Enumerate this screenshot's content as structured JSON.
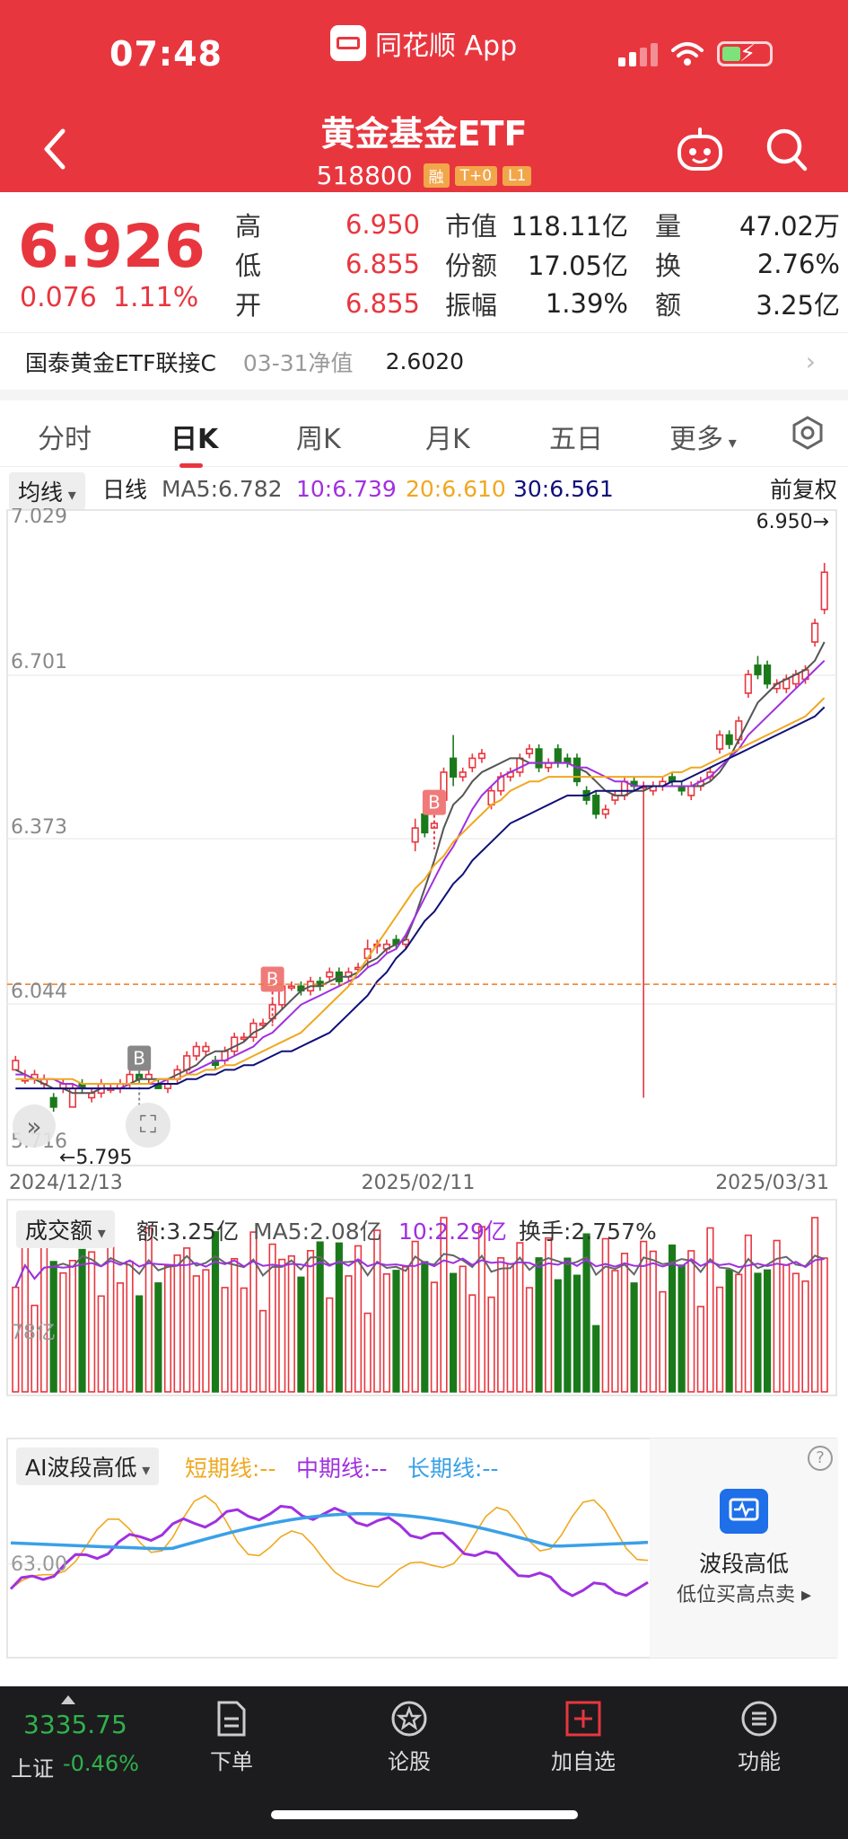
{
  "status": {
    "time": "07:48",
    "app_name": "同花顺 App"
  },
  "header": {
    "title": "黄金基金ETF",
    "code": "518800",
    "tags": [
      "融",
      "T+0",
      "L1"
    ]
  },
  "quote": {
    "price": "6.926",
    "change": "0.076",
    "change_pct": "1.11%",
    "col1": [
      {
        "label": "高",
        "value": "6.950"
      },
      {
        "label": "低",
        "value": "6.855"
      },
      {
        "label": "开",
        "value": "6.855"
      }
    ],
    "col2": [
      {
        "label": "市值",
        "value": "118.11亿"
      },
      {
        "label": "份额",
        "value": "17.05亿"
      },
      {
        "label": "振幅",
        "value": "1.39%"
      }
    ],
    "col3": [
      {
        "label": "量",
        "value": "47.02万"
      },
      {
        "label": "换",
        "value": "2.76%"
      },
      {
        "label": "额",
        "value": "3.25亿"
      }
    ]
  },
  "linked_fund": {
    "name": "国泰黄金ETF联接C",
    "date_label": "03-31净值",
    "nav": "2.6020"
  },
  "tabs": [
    {
      "label": "分时"
    },
    {
      "label": "日K"
    },
    {
      "label": "周K"
    },
    {
      "label": "月K"
    },
    {
      "label": "五日"
    },
    {
      "label": "更多"
    }
  ],
  "ma_legend": {
    "dropdown": "均线",
    "period": "日线",
    "ma5": "MA5:6.782",
    "ma10": "10:6.739",
    "ma20": "20:6.610",
    "ma30": "30:6.561",
    "adjust": "前复权"
  },
  "colors": {
    "up": "#e8363f",
    "down": "#1a7a1a",
    "ma5": "#555555",
    "ma10": "#a030e0",
    "ma20": "#f0a820",
    "ma30": "#10107a",
    "ref_line": "#f07a20"
  },
  "chart_data": {
    "type": "candlestick",
    "y_ticks": [
      "7.029",
      "6.701",
      "6.373",
      "6.044",
      "5.716"
    ],
    "ylim": [
      5.716,
      7.029
    ],
    "x_labels": [
      "2024/12/13",
      "2025/02/11",
      "2025/03/31"
    ],
    "high_label": "6.950→",
    "low_label": "←5.795",
    "ref_line": 6.044,
    "signals": [
      {
        "label": "B",
        "index": 13,
        "price": 5.8
      },
      {
        "label": "B",
        "index": 27,
        "price": 5.97
      },
      {
        "label": "B",
        "index": 44,
        "price": 6.35
      }
    ],
    "candles": [
      [
        5.86,
        5.88,
        5.87,
        5.89
      ],
      [
        5.84,
        5.84,
        5.83,
        5.86
      ],
      [
        5.84,
        5.85,
        5.83,
        5.86
      ],
      [
        5.83,
        5.84,
        5.82,
        5.85
      ],
      [
        5.8,
        5.78,
        5.77,
        5.81
      ],
      [
        5.82,
        5.83,
        5.81,
        5.84
      ],
      [
        5.78,
        5.82,
        5.78,
        5.83
      ],
      [
        5.83,
        5.82,
        5.81,
        5.84
      ],
      [
        5.8,
        5.81,
        5.79,
        5.82
      ],
      [
        5.81,
        5.83,
        5.8,
        5.84
      ],
      [
        5.82,
        5.82,
        5.81,
        5.83
      ],
      [
        5.82,
        5.83,
        5.81,
        5.84
      ],
      [
        5.83,
        5.85,
        5.82,
        5.86
      ],
      [
        5.85,
        5.84,
        5.83,
        5.86
      ],
      [
        5.84,
        5.85,
        5.83,
        5.86
      ],
      [
        5.83,
        5.82,
        5.82,
        5.84
      ],
      [
        5.82,
        5.83,
        5.81,
        5.84
      ],
      [
        5.84,
        5.86,
        5.83,
        5.87
      ],
      [
        5.86,
        5.89,
        5.85,
        5.9
      ],
      [
        5.89,
        5.91,
        5.88,
        5.92
      ],
      [
        5.9,
        5.91,
        5.89,
        5.92
      ],
      [
        5.88,
        5.87,
        5.86,
        5.89
      ],
      [
        5.88,
        5.9,
        5.87,
        5.91
      ],
      [
        5.9,
        5.93,
        5.89,
        5.94
      ],
      [
        5.93,
        5.93,
        5.92,
        5.94
      ],
      [
        5.93,
        5.96,
        5.92,
        5.97
      ],
      [
        5.96,
        5.96,
        5.95,
        5.97
      ],
      [
        5.97,
        6.0,
        5.96,
        6.01
      ],
      [
        6.0,
        6.04,
        5.99,
        6.05
      ],
      [
        6.04,
        6.04,
        6.03,
        6.05
      ],
      [
        6.04,
        6.03,
        6.02,
        6.05
      ],
      [
        6.03,
        6.05,
        6.02,
        6.06
      ],
      [
        6.05,
        6.04,
        6.03,
        6.06
      ],
      [
        6.06,
        6.07,
        6.05,
        6.08
      ],
      [
        6.07,
        6.05,
        6.04,
        6.08
      ],
      [
        6.06,
        6.07,
        6.05,
        6.08
      ],
      [
        6.08,
        6.08,
        6.07,
        6.09
      ],
      [
        6.1,
        6.12,
        6.08,
        6.14
      ],
      [
        6.13,
        6.13,
        6.11,
        6.14
      ],
      [
        6.12,
        6.13,
        6.11,
        6.14
      ],
      [
        6.14,
        6.13,
        6.12,
        6.15
      ],
      [
        6.13,
        6.14,
        6.12,
        6.15
      ],
      [
        6.35,
        6.38,
        6.33,
        6.4
      ],
      [
        6.41,
        6.37,
        6.36,
        6.42
      ],
      [
        6.38,
        6.39,
        6.38,
        6.39
      ],
      [
        6.44,
        6.5,
        6.43,
        6.51
      ],
      [
        6.53,
        6.49,
        6.47,
        6.58
      ],
      [
        6.49,
        6.5,
        6.48,
        6.51
      ],
      [
        6.51,
        6.53,
        6.5,
        6.54
      ],
      [
        6.53,
        6.54,
        6.52,
        6.55
      ],
      [
        6.43,
        6.46,
        6.42,
        6.47
      ],
      [
        6.46,
        6.49,
        6.45,
        6.5
      ],
      [
        6.49,
        6.5,
        6.48,
        6.51
      ],
      [
        6.5,
        6.53,
        6.49,
        6.54
      ],
      [
        6.54,
        6.55,
        6.53,
        6.56
      ],
      [
        6.55,
        6.51,
        6.5,
        6.56
      ],
      [
        6.51,
        6.52,
        6.5,
        6.53
      ],
      [
        6.55,
        6.52,
        6.51,
        6.56
      ],
      [
        6.53,
        6.52,
        6.51,
        6.54
      ],
      [
        6.53,
        6.48,
        6.47,
        6.54
      ],
      [
        6.46,
        6.44,
        6.43,
        6.47
      ],
      [
        6.45,
        6.41,
        6.4,
        6.46
      ],
      [
        6.41,
        6.42,
        6.4,
        6.43
      ],
      [
        6.44,
        6.45,
        6.43,
        6.46
      ],
      [
        6.45,
        6.48,
        6.44,
        6.49
      ],
      [
        6.48,
        6.47,
        6.46,
        6.49
      ],
      [
        6.47,
        6.47,
        5.8,
        6.48
      ],
      [
        6.46,
        6.47,
        6.45,
        6.48
      ],
      [
        6.47,
        6.48,
        6.46,
        6.49
      ],
      [
        6.49,
        6.48,
        6.47,
        6.5
      ],
      [
        6.47,
        6.46,
        6.45,
        6.48
      ],
      [
        6.45,
        6.47,
        6.44,
        6.48
      ],
      [
        6.47,
        6.48,
        6.46,
        6.49
      ],
      [
        6.49,
        6.5,
        6.48,
        6.51
      ],
      [
        6.55,
        6.58,
        6.54,
        6.59
      ],
      [
        6.58,
        6.56,
        6.55,
        6.59
      ],
      [
        6.57,
        6.61,
        6.56,
        6.62
      ],
      [
        6.67,
        6.71,
        6.66,
        6.72
      ],
      [
        6.73,
        6.71,
        6.7,
        6.75
      ],
      [
        6.73,
        6.69,
        6.68,
        6.74
      ],
      [
        6.68,
        6.69,
        6.67,
        6.7
      ],
      [
        6.68,
        6.7,
        6.67,
        6.71
      ],
      [
        6.69,
        6.71,
        6.68,
        6.72
      ],
      [
        6.7,
        6.72,
        6.69,
        6.73
      ],
      [
        6.78,
        6.82,
        6.77,
        6.83
      ],
      [
        6.85,
        6.93,
        6.84,
        6.95
      ]
    ],
    "ma5": [
      5.86,
      5.85,
      5.84,
      5.83,
      5.82,
      5.82,
      5.81,
      5.81,
      5.81,
      5.82,
      5.82,
      5.82,
      5.83,
      5.84,
      5.84,
      5.84,
      5.84,
      5.85,
      5.86,
      5.87,
      5.89,
      5.9,
      5.9,
      5.91,
      5.92,
      5.94,
      5.95,
      5.97,
      5.99,
      6.01,
      6.03,
      6.04,
      6.04,
      6.05,
      6.06,
      6.06,
      6.07,
      6.09,
      6.1,
      6.12,
      6.13,
      6.14,
      6.19,
      6.25,
      6.31,
      6.38,
      6.43,
      6.45,
      6.48,
      6.5,
      6.51,
      6.52,
      6.53,
      6.53,
      6.52,
      6.52,
      6.52,
      6.52,
      6.52,
      6.51,
      6.5,
      6.48,
      6.46,
      6.45,
      6.45,
      6.46,
      6.46,
      6.47,
      6.47,
      6.47,
      6.47,
      6.47,
      6.47,
      6.48,
      6.5,
      6.53,
      6.57,
      6.61,
      6.65,
      6.67,
      6.69,
      6.7,
      6.71,
      6.72,
      6.74,
      6.78
    ],
    "ma10": [
      5.85,
      5.85,
      5.84,
      5.84,
      5.84,
      5.83,
      5.83,
      5.82,
      5.82,
      5.82,
      5.82,
      5.82,
      5.83,
      5.83,
      5.83,
      5.83,
      5.84,
      5.84,
      5.85,
      5.86,
      5.87,
      5.88,
      5.88,
      5.89,
      5.9,
      5.91,
      5.93,
      5.94,
      5.96,
      5.98,
      6.0,
      6.01,
      6.02,
      6.03,
      6.04,
      6.05,
      6.06,
      6.08,
      6.09,
      6.11,
      6.12,
      6.15,
      6.19,
      6.23,
      6.27,
      6.31,
      6.34,
      6.38,
      6.42,
      6.45,
      6.47,
      6.49,
      6.5,
      6.51,
      6.52,
      6.52,
      6.52,
      6.52,
      6.52,
      6.51,
      6.51,
      6.5,
      6.49,
      6.48,
      6.48,
      6.47,
      6.47,
      6.47,
      6.47,
      6.47,
      6.47,
      6.47,
      6.48,
      6.49,
      6.51,
      6.53,
      6.55,
      6.58,
      6.6,
      6.62,
      6.64,
      6.66,
      6.68,
      6.7,
      6.72,
      6.74
    ],
    "ma20": [
      5.84,
      5.84,
      5.84,
      5.84,
      5.84,
      5.84,
      5.84,
      5.83,
      5.83,
      5.83,
      5.83,
      5.83,
      5.83,
      5.83,
      5.83,
      5.84,
      5.84,
      5.84,
      5.85,
      5.85,
      5.86,
      5.86,
      5.87,
      5.87,
      5.88,
      5.89,
      5.9,
      5.91,
      5.92,
      5.93,
      5.94,
      5.96,
      5.98,
      6.0,
      6.02,
      6.04,
      6.07,
      6.1,
      6.13,
      6.16,
      6.19,
      6.22,
      6.25,
      6.27,
      6.3,
      6.32,
      6.35,
      6.37,
      6.39,
      6.41,
      6.43,
      6.44,
      6.46,
      6.47,
      6.48,
      6.48,
      6.49,
      6.49,
      6.49,
      6.49,
      6.49,
      6.49,
      6.49,
      6.49,
      6.49,
      6.49,
      6.49,
      6.49,
      6.49,
      6.5,
      6.5,
      6.51,
      6.51,
      6.52,
      6.53,
      6.54,
      6.55,
      6.56,
      6.57,
      6.58,
      6.59,
      6.6,
      6.61,
      6.62,
      6.64,
      6.66
    ],
    "ma30": [
      5.82,
      5.82,
      5.82,
      5.82,
      5.82,
      5.82,
      5.82,
      5.82,
      5.82,
      5.82,
      5.82,
      5.82,
      5.82,
      5.82,
      5.82,
      5.83,
      5.83,
      5.83,
      5.84,
      5.84,
      5.85,
      5.85,
      5.86,
      5.86,
      5.87,
      5.87,
      5.88,
      5.89,
      5.9,
      5.9,
      5.91,
      5.92,
      5.93,
      5.94,
      5.96,
      5.98,
      6.0,
      6.02,
      6.05,
      6.07,
      6.1,
      6.12,
      6.15,
      6.18,
      6.2,
      6.23,
      6.26,
      6.28,
      6.31,
      6.33,
      6.35,
      6.37,
      6.39,
      6.4,
      6.41,
      6.42,
      6.43,
      6.44,
      6.45,
      6.45,
      6.45,
      6.46,
      6.46,
      6.46,
      6.46,
      6.46,
      6.47,
      6.47,
      6.47,
      6.48,
      6.48,
      6.49,
      6.5,
      6.51,
      6.52,
      6.53,
      6.54,
      6.55,
      6.56,
      6.57,
      6.58,
      6.59,
      6.6,
      6.61,
      6.62,
      6.64
    ]
  },
  "volume_legend": {
    "dropdown": "成交额",
    "amount": "额:3.25亿",
    "ma5": "MA5:2.08亿",
    "ma10": "10:2.29亿",
    "turnover": "换手:2.757%",
    "axis_label": "78亿"
  },
  "ai_legend": {
    "dropdown": "AI波段高低",
    "short": "短期线:--",
    "mid": "中期线:--",
    "long": "长期线:--",
    "axis_label": "63.00",
    "promo_title": "波段高低",
    "promo_sub": "低位买高点卖 ▸"
  },
  "bottom_nav": {
    "index_value": "3335.75",
    "index_name": "上证",
    "index_change": "-0.46%",
    "items": [
      {
        "label": "下单"
      },
      {
        "label": "论股"
      },
      {
        "label": "加自选"
      },
      {
        "label": "功能"
      }
    ]
  }
}
